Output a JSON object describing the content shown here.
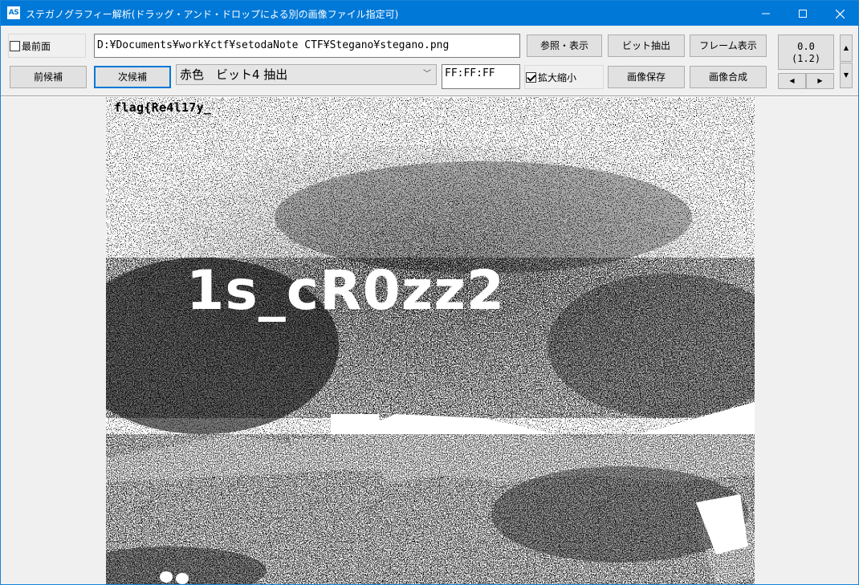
{
  "window": {
    "app_icon": "AS",
    "title": "ステガノグラフィー解析(ドラッグ・アンド・ドロップによる別の画像ファイル指定可)",
    "minimize_icon": "minimize-icon",
    "maximize_icon": "maximize-icon",
    "close_icon": "close-icon"
  },
  "toolbar": {
    "topmost_label": "最前面",
    "topmost_checked": false,
    "prev_candidate": "前候補",
    "next_candidate": "次候補",
    "file_path": "D:¥Documents¥work¥ctf¥setodaNote CTF¥Stegano¥stegano.png",
    "extract_mode": "赤色　ビット4 抽出",
    "color_value": "FF:FF:FF",
    "browse_display": "参照・表示",
    "bit_extract": "ビット抽出",
    "frame_display": "フレーム表示",
    "zoom_label": "拡大縮小",
    "zoom_checked": true,
    "save_image": "画像保存",
    "compose_image": "画像合成",
    "counter_line1": "0.0",
    "counter_line2": "(1.2)"
  },
  "image": {
    "flag_text": "flag{Re4l17y_",
    "overlay_text": "1s_cR0zz2"
  },
  "colors": {
    "titlebar": "#0078d7",
    "accent": "#0078d7"
  }
}
